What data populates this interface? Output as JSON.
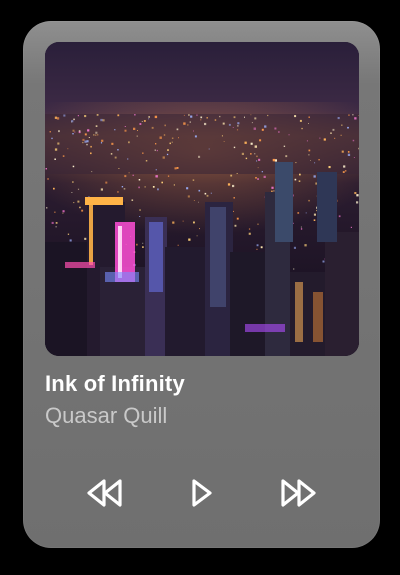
{
  "player": {
    "track_title": "Ink of Infinity",
    "artist_name": "Quasar Quill",
    "album_art": "night-city-skyline-image",
    "controls": {
      "previous_icon": "rewind-icon",
      "play_icon": "play-icon",
      "next_icon": "fast-forward-icon"
    },
    "colors": {
      "background": "#000000",
      "card": "#777777",
      "title": "#ffffff",
      "artist": "#c9c9c9",
      "icon": "#ffffff"
    }
  }
}
